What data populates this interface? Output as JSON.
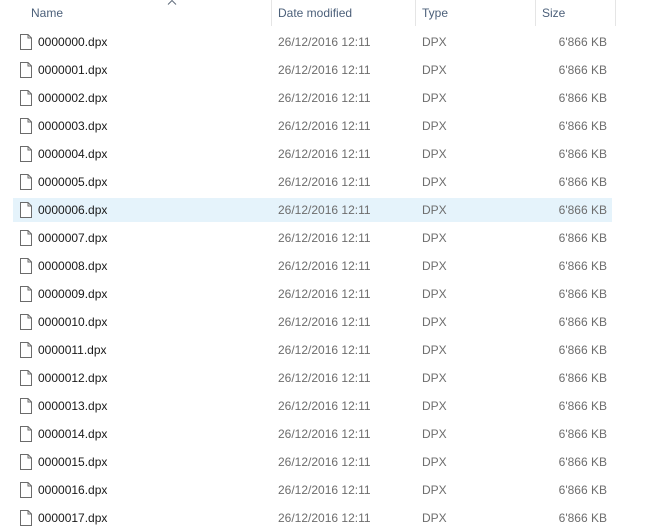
{
  "columns": {
    "name": "Name",
    "date": "Date modified",
    "type": "Type",
    "size": "Size"
  },
  "sort": {
    "column": "name",
    "icon": "sort-up-chevron-icon"
  },
  "hovered_row_index": 6,
  "files": [
    {
      "name": "0000000.dpx",
      "date": "26/12/2016 12:11",
      "type": "DPX",
      "size": "6'866 KB"
    },
    {
      "name": "0000001.dpx",
      "date": "26/12/2016 12:11",
      "type": "DPX",
      "size": "6'866 KB"
    },
    {
      "name": "0000002.dpx",
      "date": "26/12/2016 12:11",
      "type": "DPX",
      "size": "6'866 KB"
    },
    {
      "name": "0000003.dpx",
      "date": "26/12/2016 12:11",
      "type": "DPX",
      "size": "6'866 KB"
    },
    {
      "name": "0000004.dpx",
      "date": "26/12/2016 12:11",
      "type": "DPX",
      "size": "6'866 KB"
    },
    {
      "name": "0000005.dpx",
      "date": "26/12/2016 12:11",
      "type": "DPX",
      "size": "6'866 KB"
    },
    {
      "name": "0000006.dpx",
      "date": "26/12/2016 12:11",
      "type": "DPX",
      "size": "6'866 KB"
    },
    {
      "name": "0000007.dpx",
      "date": "26/12/2016 12:11",
      "type": "DPX",
      "size": "6'866 KB"
    },
    {
      "name": "0000008.dpx",
      "date": "26/12/2016 12:11",
      "type": "DPX",
      "size": "6'866 KB"
    },
    {
      "name": "0000009.dpx",
      "date": "26/12/2016 12:11",
      "type": "DPX",
      "size": "6'866 KB"
    },
    {
      "name": "0000010.dpx",
      "date": "26/12/2016 12:11",
      "type": "DPX",
      "size": "6'866 KB"
    },
    {
      "name": "0000011.dpx",
      "date": "26/12/2016 12:11",
      "type": "DPX",
      "size": "6'866 KB"
    },
    {
      "name": "0000012.dpx",
      "date": "26/12/2016 12:11",
      "type": "DPX",
      "size": "6'866 KB"
    },
    {
      "name": "0000013.dpx",
      "date": "26/12/2016 12:11",
      "type": "DPX",
      "size": "6'866 KB"
    },
    {
      "name": "0000014.dpx",
      "date": "26/12/2016 12:11",
      "type": "DPX",
      "size": "6'866 KB"
    },
    {
      "name": "0000015.dpx",
      "date": "26/12/2016 12:11",
      "type": "DPX",
      "size": "6'866 KB"
    },
    {
      "name": "0000016.dpx",
      "date": "26/12/2016 12:11",
      "type": "DPX",
      "size": "6'866 KB"
    },
    {
      "name": "0000017.dpx",
      "date": "26/12/2016 12:11",
      "type": "DPX",
      "size": "6'866 KB"
    }
  ]
}
